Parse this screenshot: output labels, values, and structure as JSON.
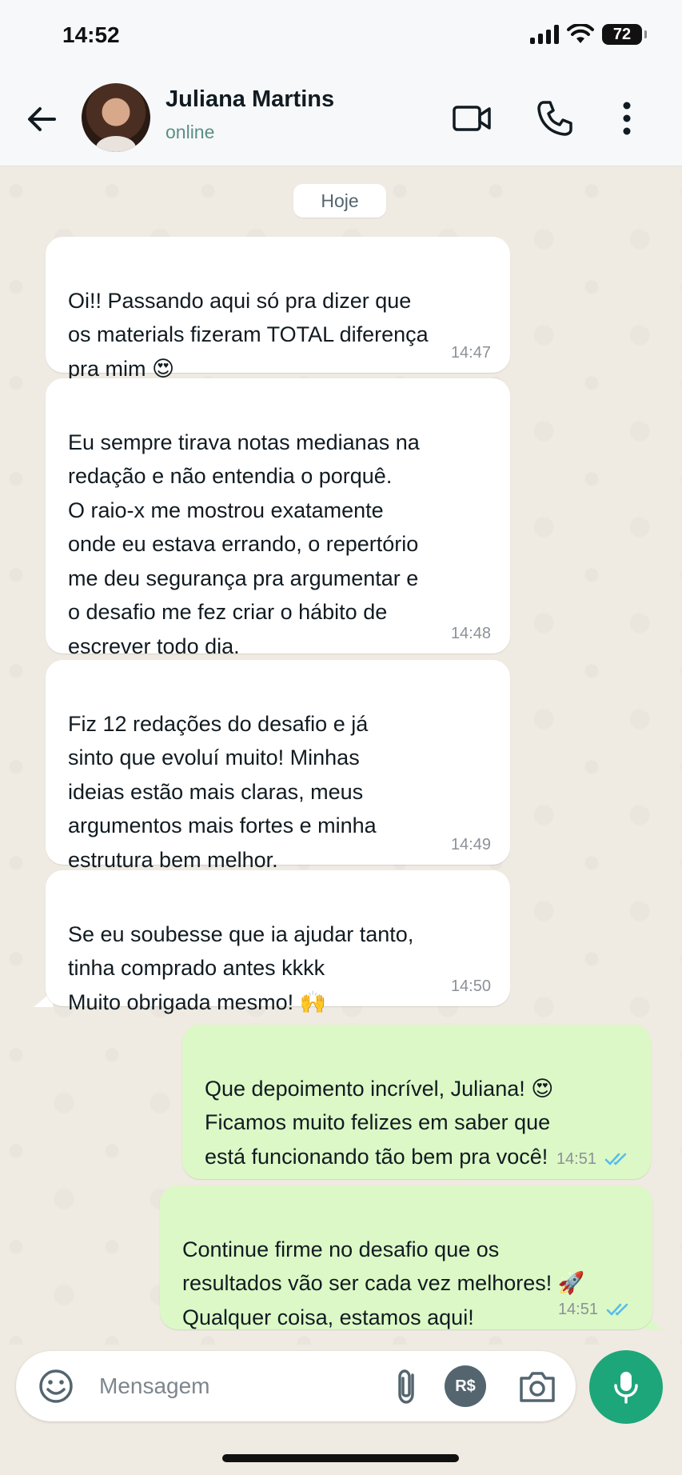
{
  "status_bar": {
    "time": "14:52",
    "battery": "72",
    "icons": [
      "signal-icon",
      "wifi-icon",
      "battery-icon"
    ]
  },
  "header": {
    "back_icon": "arrow-left-icon",
    "contact_name": "Juliana Martins",
    "contact_status": "online",
    "actions": [
      "video-call-icon",
      "phone-icon",
      "more-vertical-icon"
    ]
  },
  "chat": {
    "date_label": "Hoje",
    "messages": [
      {
        "direction": "in",
        "text": "Oi!! Passando aqui só pra dizer que\nos materials fizeram TOTAL diferença\npra mim 😍",
        "time": "14:47"
      },
      {
        "direction": "in",
        "text": "Eu sempre tirava notas medianas na\nredação e não entendia o porquê.\nO raio-x me mostrou exatamente\nonde eu estava errando, o repertório\nme deu segurança pra argumentar e\no desafio me fez criar o hábito de\nescrever todo dia.",
        "time": "14:48"
      },
      {
        "direction": "in",
        "text": "Fiz 12 redações do desafio e já\nsinto que evoluí muito! Minhas\nideias estão mais claras, meus\nargumentos mais fortes e minha\nestrutura bem melhor.",
        "time": "14:49"
      },
      {
        "direction": "in",
        "text": "Se eu soubesse que ia ajudar tanto,\ntinha comprado antes kkkk\nMuito obrigada mesmo! 🙌",
        "time": "14:50"
      },
      {
        "direction": "out",
        "text": "Que depoimento incrível, Juliana! 😍\nFicamos muito felizes em saber que\nestá funcionando tão bem pra você!",
        "time": "14:51",
        "status": "read"
      },
      {
        "direction": "out",
        "text": "Continue firme no desafio que os\nresultados vão ser cada vez melhores! 🚀\nQualquer coisa, estamos aqui!",
        "time": "14:51",
        "status": "read"
      }
    ]
  },
  "input": {
    "placeholder": "Mensagem",
    "value": "",
    "icons": [
      "emoji-icon",
      "paperclip-icon",
      "payment-icon",
      "camera-icon",
      "microphone-icon"
    ],
    "pay_label": "R$"
  },
  "colors": {
    "accent": "#1da67a",
    "outgoing_bubble": "#dcf8c6",
    "incoming_bubble": "#ffffff",
    "chat_background": "#efeae2",
    "read_ticks": "#53bdeb",
    "status_online": "#5b8f84"
  }
}
